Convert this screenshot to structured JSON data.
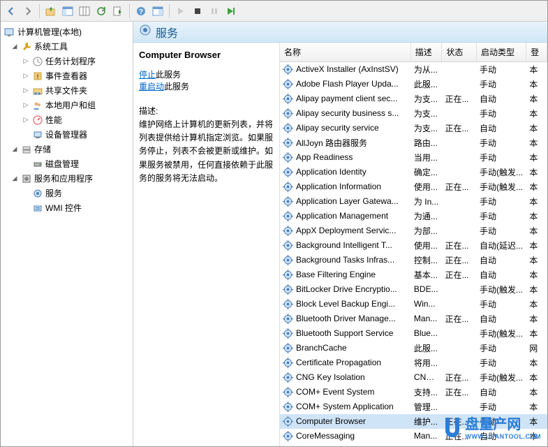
{
  "toolbar": {
    "back": "←",
    "fwd": "→",
    "up": "folder-up",
    "views": "views",
    "cols": "cols",
    "refresh": "refresh",
    "export": "export",
    "help": "help",
    "play_lg": "play",
    "stop": "■",
    "pause": "||",
    "play": "▶"
  },
  "tree": {
    "root": {
      "label": "计算机管理(本地)"
    },
    "systools": {
      "label": "系统工具"
    },
    "scheduler": {
      "label": "任务计划程序"
    },
    "eventviewer": {
      "label": "事件查看器"
    },
    "shared": {
      "label": "共享文件夹"
    },
    "localusers": {
      "label": "本地用户和组"
    },
    "perf": {
      "label": "性能"
    },
    "devmgr": {
      "label": "设备管理器"
    },
    "storage": {
      "label": "存储"
    },
    "diskmgmt": {
      "label": "磁盘管理"
    },
    "svcapps": {
      "label": "服务和应用程序"
    },
    "services": {
      "label": "服务"
    },
    "wmi": {
      "label": "WMI 控件"
    }
  },
  "header": {
    "title": "服务"
  },
  "detail": {
    "title": "Computer Browser",
    "stop_label": "停止",
    "stop_suffix": "此服务",
    "restart_label": "重启动",
    "restart_suffix": "此服务",
    "desc_label": "描述:",
    "desc": "维护网络上计算机的更新列表，并将列表提供给计算机指定浏览。如果服务停止，列表不会被更新或维护。如果服务被禁用，任何直接依赖于此服务的服务将无法启动。"
  },
  "columns": {
    "name": "名称",
    "desc": "描述",
    "status": "状态",
    "start": "启动类型",
    "logon": "登"
  },
  "services": [
    {
      "name": "ActiveX Installer (AxInstSV)",
      "desc": "为从...",
      "status": "",
      "start": "手动",
      "logon": "本"
    },
    {
      "name": "Adobe Flash Player Upda...",
      "desc": "此服...",
      "status": "",
      "start": "手动",
      "logon": "本"
    },
    {
      "name": "Alipay payment client sec...",
      "desc": "为支...",
      "status": "正在...",
      "start": "自动",
      "logon": "本"
    },
    {
      "name": "Alipay security business s...",
      "desc": "为支...",
      "status": "",
      "start": "手动",
      "logon": "本"
    },
    {
      "name": "Alipay security service",
      "desc": "为支...",
      "status": "正在...",
      "start": "自动",
      "logon": "本"
    },
    {
      "name": "AllJoyn 路由器服务",
      "desc": "路由...",
      "status": "",
      "start": "手动",
      "logon": "本"
    },
    {
      "name": "App Readiness",
      "desc": "当用...",
      "status": "",
      "start": "手动",
      "logon": "本"
    },
    {
      "name": "Application Identity",
      "desc": "确定...",
      "status": "",
      "start": "手动(触发...",
      "logon": "本"
    },
    {
      "name": "Application Information",
      "desc": "使用...",
      "status": "正在...",
      "start": "手动(触发...",
      "logon": "本"
    },
    {
      "name": "Application Layer Gatewa...",
      "desc": "为 In...",
      "status": "",
      "start": "手动",
      "logon": "本"
    },
    {
      "name": "Application Management",
      "desc": "为通...",
      "status": "",
      "start": "手动",
      "logon": "本"
    },
    {
      "name": "AppX Deployment Servic...",
      "desc": "为部...",
      "status": "",
      "start": "手动",
      "logon": "本"
    },
    {
      "name": "Background Intelligent T...",
      "desc": "使用...",
      "status": "正在...",
      "start": "自动(延迟...",
      "logon": "本"
    },
    {
      "name": "Background Tasks Infras...",
      "desc": "控制...",
      "status": "正在...",
      "start": "自动",
      "logon": "本"
    },
    {
      "name": "Base Filtering Engine",
      "desc": "基本...",
      "status": "正在...",
      "start": "自动",
      "logon": "本"
    },
    {
      "name": "BitLocker Drive Encryptio...",
      "desc": "BDE...",
      "status": "",
      "start": "手动(触发...",
      "logon": "本"
    },
    {
      "name": "Block Level Backup Engi...",
      "desc": "Win...",
      "status": "",
      "start": "手动",
      "logon": "本"
    },
    {
      "name": "Bluetooth Driver Manage...",
      "desc": "Man...",
      "status": "正在...",
      "start": "自动",
      "logon": "本"
    },
    {
      "name": "Bluetooth Support Service",
      "desc": "Blue...",
      "status": "",
      "start": "手动(触发...",
      "logon": "本"
    },
    {
      "name": "BranchCache",
      "desc": "此服...",
      "status": "",
      "start": "手动",
      "logon": "网"
    },
    {
      "name": "Certificate Propagation",
      "desc": "将用...",
      "status": "",
      "start": "手动",
      "logon": "本"
    },
    {
      "name": "CNG Key Isolation",
      "desc": "CNG...",
      "status": "正在...",
      "start": "手动(触发...",
      "logon": "本"
    },
    {
      "name": "COM+ Event System",
      "desc": "支持...",
      "status": "正在...",
      "start": "自动",
      "logon": "本"
    },
    {
      "name": "COM+ System Application",
      "desc": "管理...",
      "status": "",
      "start": "手动",
      "logon": "本"
    },
    {
      "name": "Computer Browser",
      "desc": "维护...",
      "status": "正在...",
      "start": "手动",
      "logon": "本",
      "selected": true
    },
    {
      "name": "CoreMessaging",
      "desc": "Man...",
      "status": "正在...",
      "start": "自动",
      "logon": "本"
    }
  ],
  "watermark": {
    "main": "盘量产网",
    "sub": "WWW.UPANTOOL.COM"
  }
}
